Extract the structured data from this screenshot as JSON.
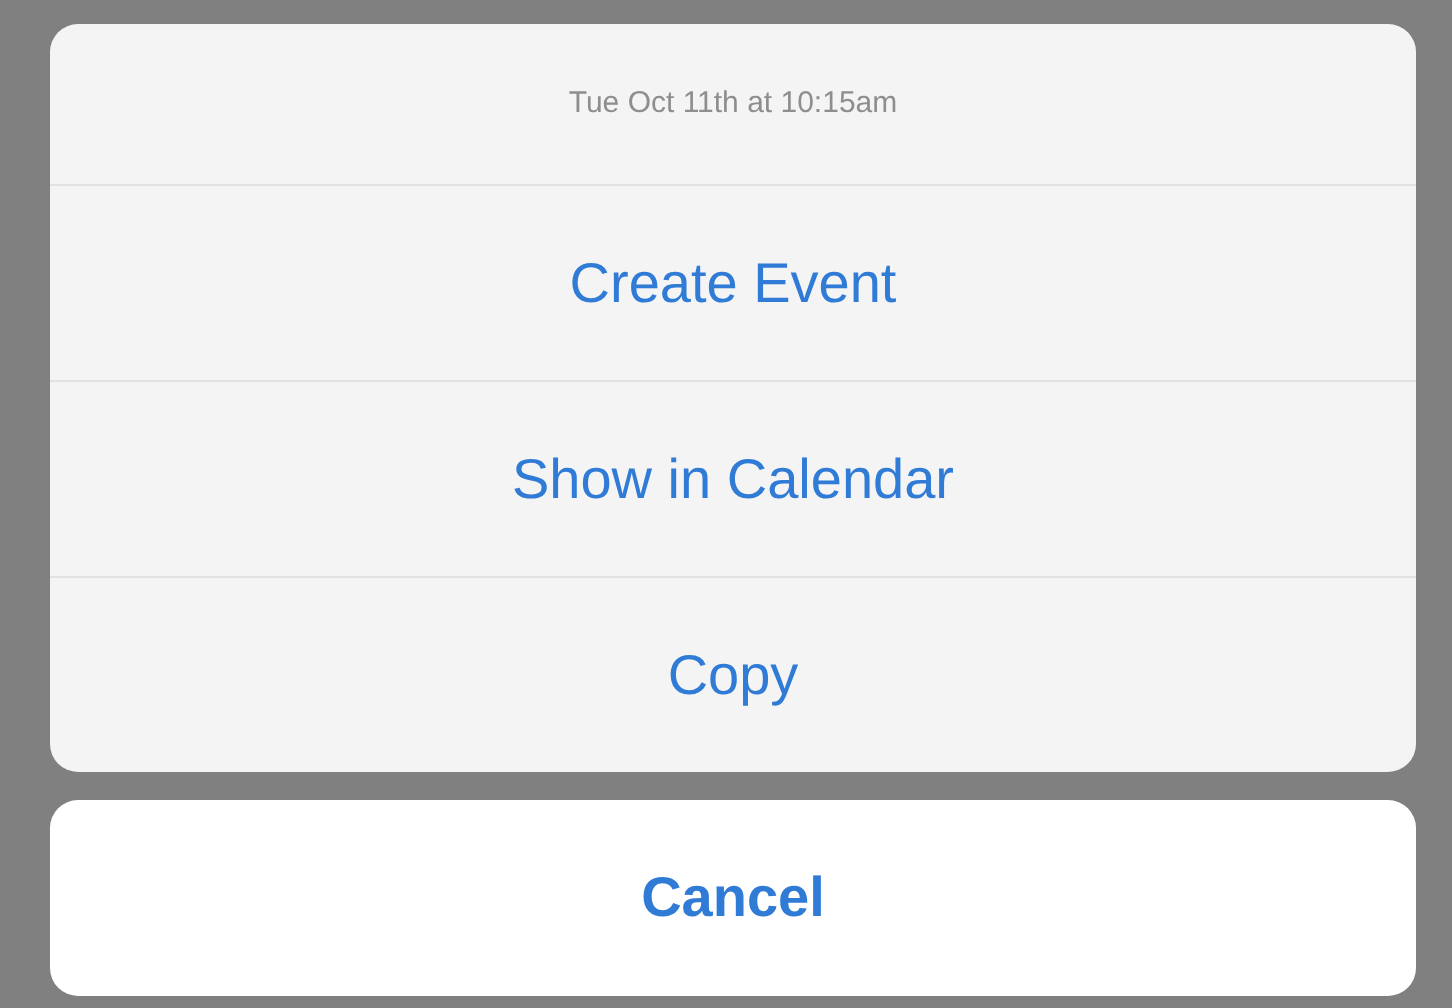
{
  "action_sheet": {
    "title": "Tue Oct 11th at 10:15am",
    "actions": [
      {
        "label": "Create Event"
      },
      {
        "label": "Show in Calendar"
      },
      {
        "label": "Copy"
      }
    ]
  },
  "cancel": {
    "label": "Cancel"
  }
}
